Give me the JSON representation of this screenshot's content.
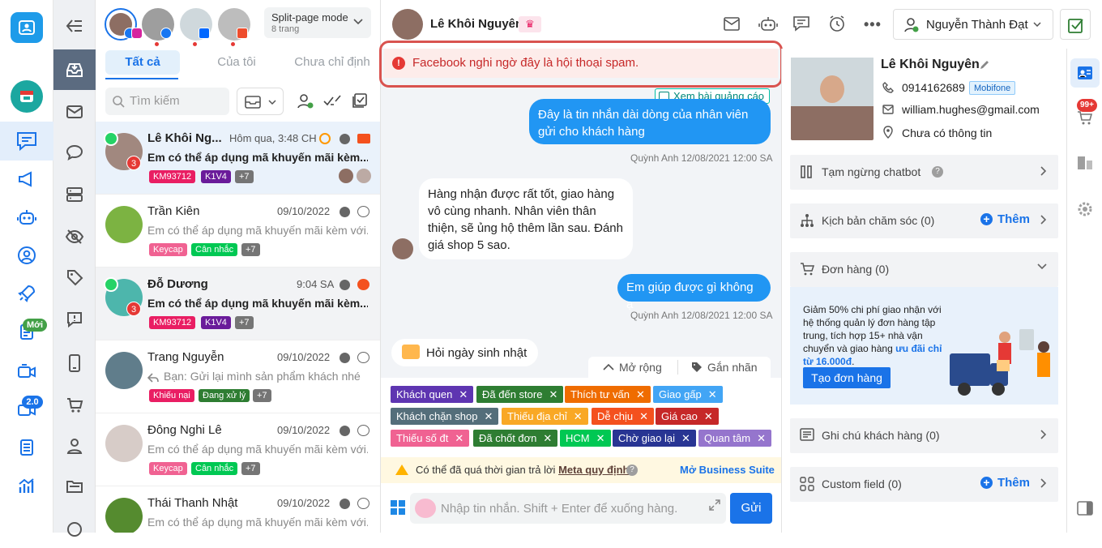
{
  "rail": {
    "badge_moi": "Mới",
    "badge_version": "2.0"
  },
  "pages_header": {
    "mode_title": "Split-page mode",
    "mode_sub": "8 trang"
  },
  "tabs": {
    "all": "Tất cả",
    "mine": "Của tôi",
    "unassigned": "Chưa chỉ định"
  },
  "search": {
    "placeholder": "Tìm kiếm"
  },
  "conversations": [
    {
      "name": "Lê Khôi Ng...",
      "time": "Hôm qua, 3:48 CH",
      "preview": "Em có thể áp dụng mã khuyến mãi kèm...",
      "badge": "3",
      "tags": [
        "KM93712",
        "K1V4",
        "+7"
      ]
    },
    {
      "name": "Trần Kiên",
      "time": "09/10/2022",
      "preview": "Em có thể áp dụng mã khuyến mãi kèm với...",
      "tags": [
        "Keycap",
        "Cân nhắc",
        "+7"
      ]
    },
    {
      "name": "Đỗ Dương",
      "time": "9:04 SA",
      "preview": "Em có thể áp dụng mã khuyến mãi kèm...",
      "badge": "3",
      "tags": [
        "KM93712",
        "K1V4",
        "+7"
      ]
    },
    {
      "name": "Trang Nguyễn",
      "time": "09/10/2022",
      "preview": "Bạn: Gửi lại mình sản phẩm khách nhé",
      "tags": [
        "Khiếu nại",
        "Đang xử lý",
        "+7"
      ]
    },
    {
      "name": "Đông Nghi Lê",
      "time": "09/10/2022",
      "preview": "Em có thể áp dụng mã khuyến mãi kèm với...",
      "tags": [
        "Keycap",
        "Cân nhắc",
        "+7"
      ]
    },
    {
      "name": "Thái Thanh Nhật",
      "time": "09/10/2022",
      "preview": "Em có thể áp dụng mã khuyến mãi kèm với..."
    }
  ],
  "chat": {
    "contact_name": "Lê Khôi Nguyên",
    "assignee": "Nguyễn Thành Đạt",
    "spam_warning": "Facebook nghi ngờ đây là hội thoại spam.",
    "ad_link": "Xem bài quảng cáo",
    "msg1": "Đây là tin nhắn dài dòng của nhân viên gửi cho khách hàng",
    "stamp1": "Quỳnh Anh 12/08/2021 12:00 SA",
    "msg2": "Hàng nhận được rất tốt, giao hàng vô cùng nhanh. Nhân viên thân thiện, sẽ ủng hộ thêm lần sau. Đánh giá shop 5 sao.",
    "msg3": "Em giúp được gì không ạ",
    "stamp2": "Quỳnh Anh 12/08/2021 12:00 SA",
    "birthday": "Hỏi ngày sinh nhật",
    "expand": "Mở rộng",
    "attach_label": "Gắn nhãn",
    "labels": [
      {
        "text": "Khách quen",
        "color": "#5e35b1"
      },
      {
        "text": "Đã đến store",
        "color": "#2e7d32"
      },
      {
        "text": "Thích tư vấn",
        "color": "#ef6c00"
      },
      {
        "text": "Giao gấp",
        "color": "#42a5f5"
      },
      {
        "text": "Khách chặn shop",
        "color": "#546e7a"
      },
      {
        "text": "Thiếu địa chỉ",
        "color": "#f9a825"
      },
      {
        "text": "Dễ chịu",
        "color": "#f4511e"
      },
      {
        "text": "Giá cao",
        "color": "#c62828"
      },
      {
        "text": "Thiếu số đt",
        "color": "#f06292"
      },
      {
        "text": "Đã chốt đơn",
        "color": "#2e7d32"
      },
      {
        "text": "HCM",
        "color": "#00c853"
      },
      {
        "text": "Chờ giao lại",
        "color": "#283593"
      },
      {
        "text": "Quan tâm",
        "color": "#9575cd"
      }
    ],
    "meta_warning": "Có thể đã quá thời gian trả lời",
    "meta_link": "Meta quy định",
    "business_suite": "Mở Business Suite",
    "composer_placeholder": "Nhập tin nhắn. Shift + Enter để xuống hàng.",
    "send": "Gửi"
  },
  "profile": {
    "name": "Lê Khôi Nguyên",
    "phone": "0914162689",
    "carrier": "Mobifone",
    "email": "william.hughes@gmail.com",
    "address": "Chưa có thông tin",
    "cart_badge": "99+"
  },
  "sections": {
    "chatbot": "Tạm ngừng chatbot",
    "care": "Kịch bản chăm sóc (0)",
    "orders": "Đơn hàng (0)",
    "promo_pre": "Giảm 50% chi phí giao nhận với hệ thống quản lý đơn hàng tập trung, tích hợp 15+ nhà vận chuyển và giao hàng ",
    "promo_highlight": "ưu đãi chỉ từ 16.000đ",
    "promo_post": ".",
    "create_order": "Tạo đơn hàng",
    "notes": "Ghi chú khách hàng (0)",
    "custom": "Custom field (0)",
    "add": "Thêm"
  }
}
